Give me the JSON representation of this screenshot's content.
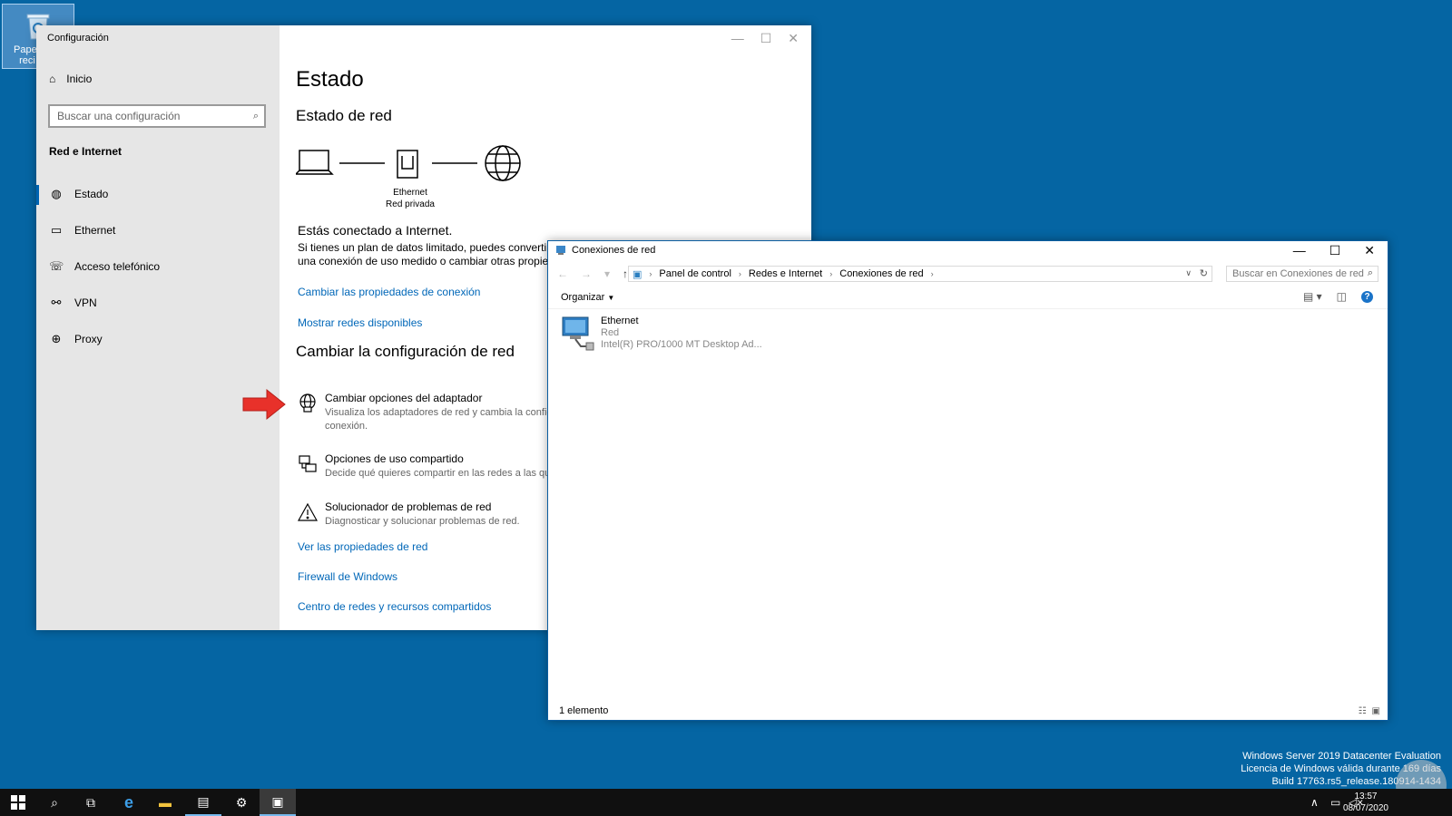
{
  "desktop": {
    "recycle_label": "Papel\nreci"
  },
  "settings": {
    "title": "Configuración",
    "home_label": "Inicio",
    "search_placeholder": "Buscar una configuración",
    "section_title": "Red e Internet",
    "nav": [
      {
        "label": "Estado",
        "icon": "status-globe-icon"
      },
      {
        "label": "Ethernet",
        "icon": "ethernet-icon"
      },
      {
        "label": "Acceso telefónico",
        "icon": "dialup-icon"
      },
      {
        "label": "VPN",
        "icon": "vpn-icon"
      },
      {
        "label": "Proxy",
        "icon": "globe-icon"
      }
    ],
    "page_title": "Estado",
    "network_status_title": "Estado de red",
    "diagram_label_1": "Ethernet",
    "diagram_label_2": "Red privada",
    "connected_text": "Estás conectado a Internet.",
    "desc_line_1": "Si tienes un plan de datos limitado, puedes convertir e",
    "desc_line_2": "una conexión de uso medido o cambiar otras propieda",
    "link_connection_props": "Cambiar las propiedades de conexión",
    "link_show_networks": "Mostrar redes disponibles",
    "change_config_title": "Cambiar la configuración de red",
    "options": [
      {
        "title": "Cambiar opciones del adaptador",
        "desc_1": "Visualiza los adaptadores de red y cambia la configu",
        "desc_2": "conexión."
      },
      {
        "title": "Opciones de uso compartido",
        "desc_1": "Decide qué quieres compartir en las redes a las que"
      },
      {
        "title": "Solucionador de problemas de red",
        "desc_1": "Diagnosticar y solucionar problemas de red."
      }
    ],
    "link_network_props": "Ver las propiedades de red",
    "link_firewall": "Firewall de Windows",
    "link_center": "Centro de redes y recursos compartidos"
  },
  "explorer": {
    "title": "Conexiones de red",
    "breadcrumb": [
      "Panel de control",
      "Redes e Internet",
      "Conexiones de red"
    ],
    "search_placeholder": "Buscar en Conexiones de red",
    "organize_label": "Organizar",
    "item": {
      "name": "Ethernet",
      "line_1": "Red",
      "line_2": "Intel(R) PRO/1000 MT Desktop Ad..."
    },
    "status_text": "1 elemento"
  },
  "watermark": {
    "line_1": "Windows Server 2019 Datacenter Evaluation",
    "line_2": "Licencia de Windows válida durante 169 días",
    "line_3": "Build 17763.rs5_release.180914-1434"
  },
  "taskbar": {
    "time": "13:57",
    "date": "08/07/2020"
  },
  "colors": {
    "desktop": "#0565a3",
    "link": "#0067b8",
    "accent": "#0063b1",
    "arrow": "#e8312a"
  }
}
